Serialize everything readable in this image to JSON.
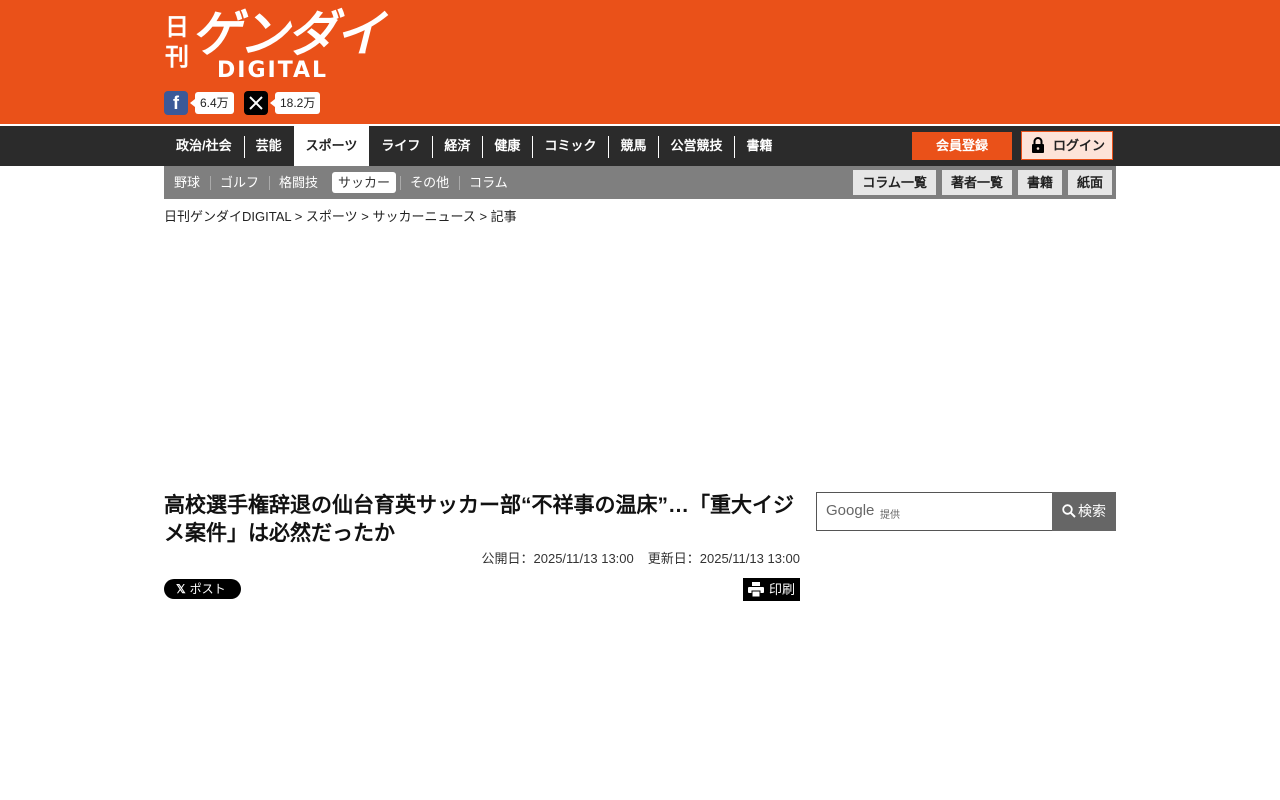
{
  "header": {
    "logo": {
      "nikkan": "日刊",
      "gendai": "ゲンダイ",
      "digital": "DIGITAL"
    },
    "brand_color": "#ea5119",
    "social": [
      {
        "icon": "facebook-icon",
        "count": "6.4万"
      },
      {
        "icon": "x-icon",
        "count": "18.2万"
      }
    ]
  },
  "mainnav": {
    "items": [
      "政治/社会",
      "芸能",
      "スポーツ",
      "ライフ",
      "経済",
      "健康",
      "コミック",
      "競馬",
      "公営競技",
      "書籍"
    ],
    "active": "スポーツ",
    "register_label": "会員登録",
    "login_label": "ログイン"
  },
  "subnav": {
    "items": [
      "野球",
      "ゴルフ",
      "格闘技",
      "サッカー",
      "その他",
      "コラム"
    ],
    "active": "サッカー",
    "right_buttons": [
      "コラム一覧",
      "著者一覧",
      "書籍",
      "紙面"
    ]
  },
  "breadcrumb": "日刊ゲンダイDIGITAL > スポーツ > サッカーニュース > 記事",
  "article": {
    "title": "高校選手権辞退の仙台育英サッカー部“不祥事の温床”…「重大イジメ案件」は必然だったか",
    "published": "公開日：2025/11/13 13:00",
    "updated": "更新日：2025/11/13 13:00",
    "x_post_label": "ポスト",
    "print_label": "印刷"
  },
  "search": {
    "provider": "Google",
    "provided_label": "提供",
    "button_label": "検索"
  }
}
